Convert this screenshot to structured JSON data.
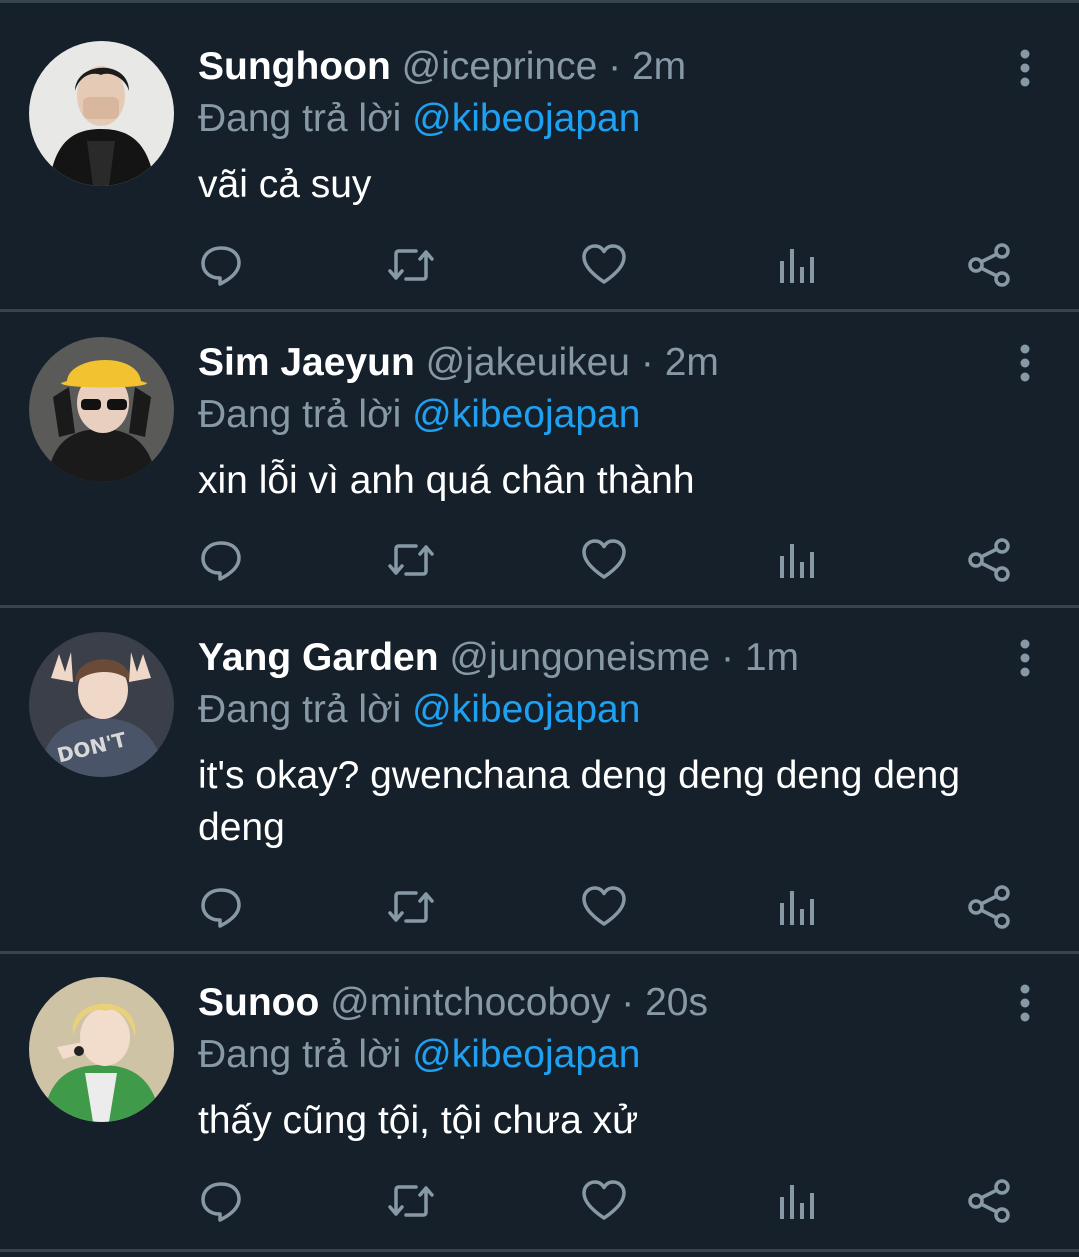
{
  "reply_prefix": "Đang trả lời",
  "tweets": [
    {
      "name": "Sunghoon",
      "handle": "@iceprince",
      "separator": "·",
      "time": "2m",
      "reply_to": "@kibeojapan",
      "text": "vãi cả suy"
    },
    {
      "name": "Sim Jaeyun",
      "handle": "@jakeuikeu",
      "separator": "·",
      "time": "2m",
      "reply_to": "@kibeojapan",
      "text": "xin lỗi vì anh quá chân thành"
    },
    {
      "name": "Yang Garden",
      "handle": "@jungoneisme",
      "separator": "·",
      "time": "1m",
      "reply_to": "@kibeojapan",
      "text": "it's okay? gwenchana deng deng deng deng deng"
    },
    {
      "name": "Sunoo",
      "handle": "@mintchocoboy",
      "separator": "·",
      "time": "20s",
      "reply_to": "@kibeojapan",
      "text": "thấy cũng tội, tội chưa xử"
    }
  ],
  "icons": {
    "reply": "reply-icon",
    "retweet": "retweet-icon",
    "like": "heart-icon",
    "analytics": "analytics-icon",
    "share": "share-icon",
    "more": "more-vertical-icon"
  },
  "colors": {
    "background": "#15202b",
    "divider": "#38444d",
    "secondary_text": "#8899a6",
    "mention": "#1da1f2",
    "primary_text": "#ffffff"
  }
}
